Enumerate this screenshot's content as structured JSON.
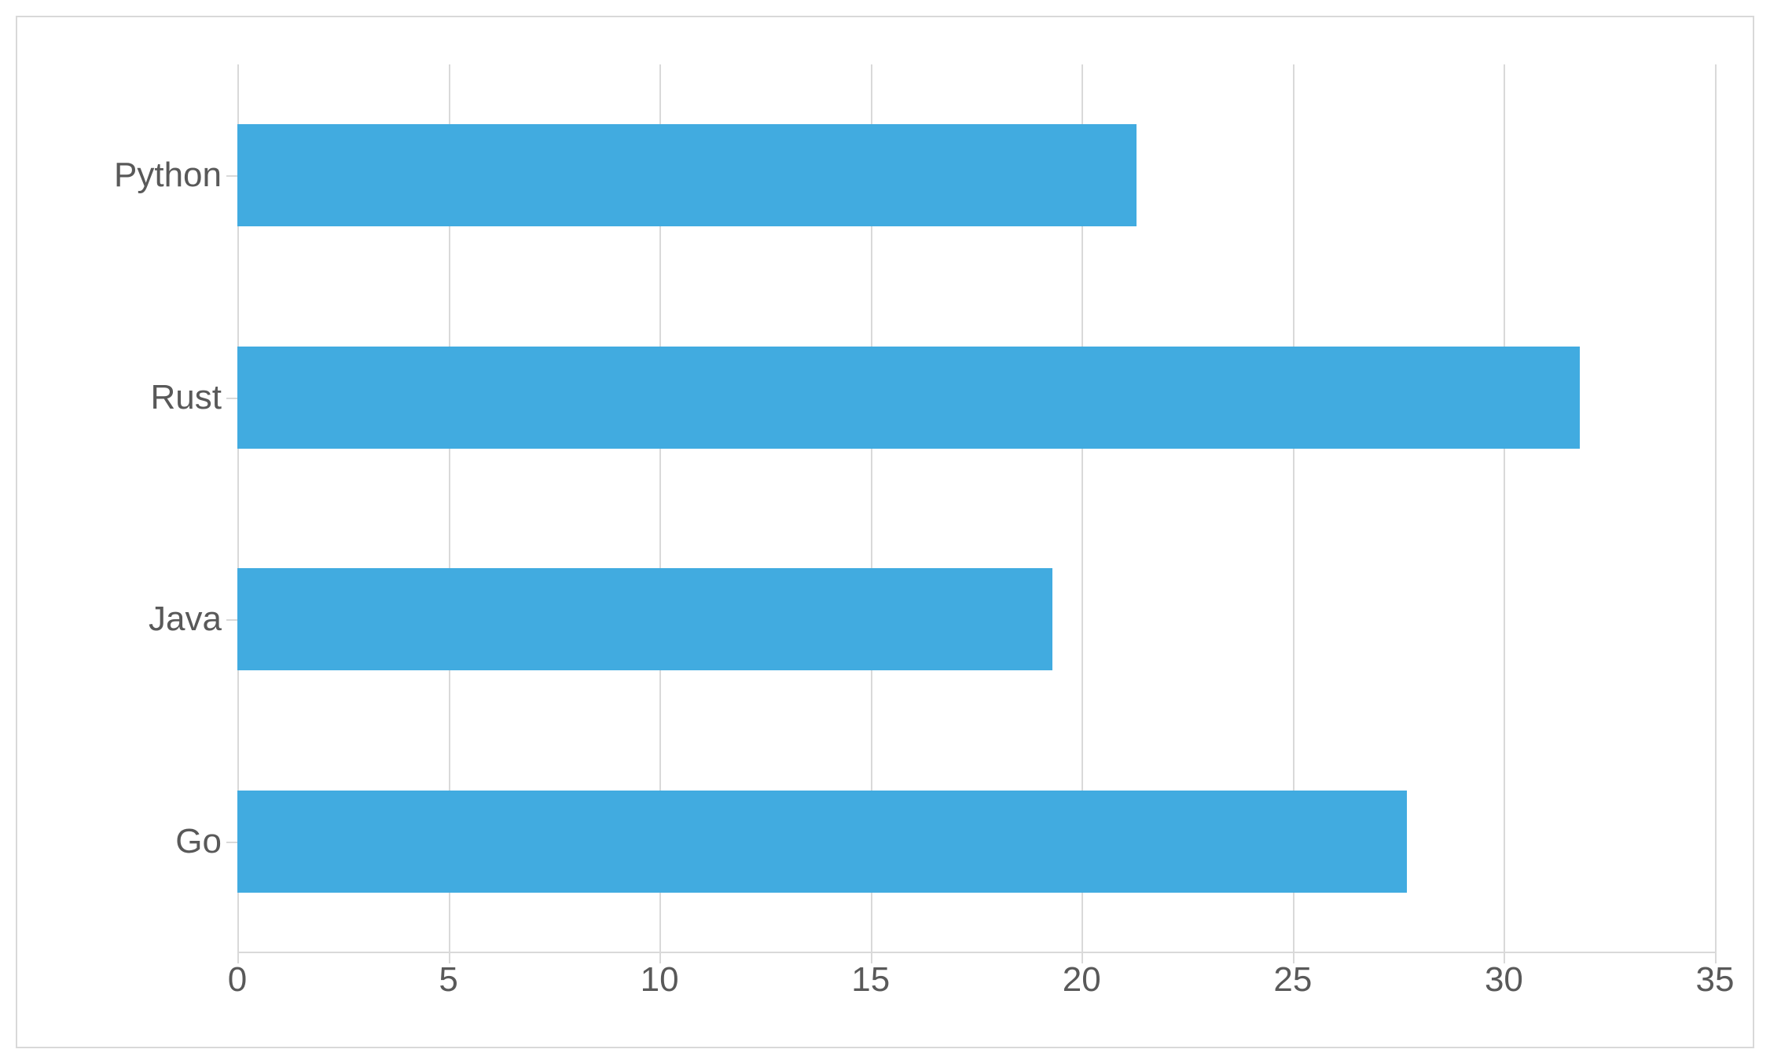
{
  "chart_data": {
    "type": "bar",
    "orientation": "horizontal",
    "categories": [
      "Go",
      "Java",
      "Rust",
      "Python"
    ],
    "values": [
      27.7,
      19.3,
      31.8,
      21.3
    ],
    "x_ticks": [
      0,
      5,
      10,
      15,
      20,
      25,
      30,
      35
    ],
    "xlim": [
      0,
      35
    ],
    "bar_color": "#41abe0",
    "gridline_color": "#d9d9d9",
    "title": "",
    "xlabel": "",
    "ylabel": ""
  }
}
